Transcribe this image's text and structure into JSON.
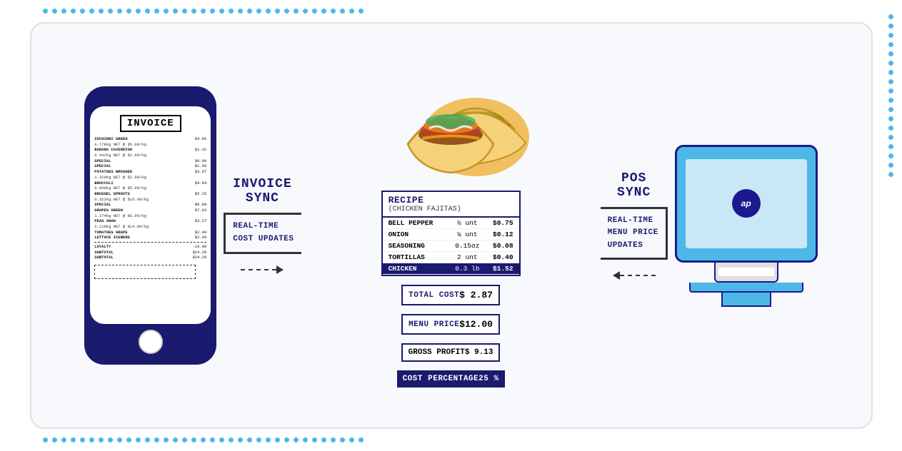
{
  "decoration": {
    "dot_color": "#4db8e8",
    "dot_count_top": 35,
    "dot_count_right": 18
  },
  "phone": {
    "invoice_title": "INVOICE",
    "items": [
      {
        "name": "ZUCHINNI GREEN",
        "price": "$4.66",
        "sub": "0.778kg NET @ $5.99/kg"
      },
      {
        "name": "BANANA CAVENDISH",
        "price": "$1.32",
        "sub": "0.442kg NET @ $2.99/kg"
      },
      {
        "name": "SPECIAL",
        "price": "$0.99"
      },
      {
        "name": "SPECIAL",
        "price": "$1.50"
      },
      {
        "name": "POTATOES BRUSHED",
        "price": "$3.97",
        "sub": "1.329kg NET @ $2.99/kg"
      },
      {
        "name": "BROCCOLI",
        "price": "$4.84",
        "sub": "0.808kg NET @ $5.99/kg"
      },
      {
        "name": "BRUSSEL SPROUTS",
        "price": "$5.15",
        "sub": "0.322kg NET @ $15.99/kg"
      },
      {
        "name": "SPECIAL",
        "price": "$0.99"
      },
      {
        "name": "GRAPES GREEN",
        "price": "$7.03",
        "sub": "1.174kg NET @ $5.99/kg"
      },
      {
        "name": "PEAS SNOW",
        "price": "$3.27",
        "sub": "0.218kg NET @ $14.99/kg"
      },
      {
        "name": "TOMATOES GRAPE",
        "price": "$2.99"
      },
      {
        "name": "LETTUCE ICEBERG",
        "price": "$2.49"
      },
      {
        "name": "LOYALTY",
        "price": "-15.00"
      },
      {
        "name": "SUBTOTAL",
        "price": "$24.20"
      },
      {
        "name": "SUBTOTAL",
        "price": "$24.20"
      }
    ]
  },
  "invoice_sync": {
    "title_line1": "INVOICE",
    "title_line2": "SYNC",
    "bracket_line1": "REAL-TIME",
    "bracket_line2": "COST UPDATES"
  },
  "recipe": {
    "title": "RECIPE",
    "subtitle": "(CHICKEN FAJITAS)",
    "ingredients": [
      {
        "name": "BELL PEPPER",
        "qty": "½ unt",
        "price": "$0.75"
      },
      {
        "name": "ONION",
        "qty": "¼ unt",
        "price": "$0.12"
      },
      {
        "name": "SEASONING",
        "qty": "0.15oz",
        "price": "$0.08"
      },
      {
        "name": "TORTILLAS",
        "qty": "2 unt",
        "price": "$0.40"
      },
      {
        "name": "CHICKEN",
        "qty": "0.3 lb",
        "price": "$1.52"
      }
    ],
    "total_cost_label": "TOTAL COST",
    "total_cost_value": "$ 2.87",
    "menu_price_label": "MENU PRICE",
    "menu_price_value": "$12.00",
    "gross_profit_label": "GROSS PROFIT",
    "gross_profit_value": "$ 9.13",
    "cost_pct_label": "COST PERCENTAGE",
    "cost_pct_value": "25 %"
  },
  "pos_sync": {
    "title_line1": "POS",
    "title_line2": "SYNC",
    "bracket_line1": "REAL-TIME",
    "bracket_line2": "MENU PRICE",
    "bracket_line3": "UPDATES"
  },
  "pos_monitor": {
    "logo_text": "ap"
  }
}
